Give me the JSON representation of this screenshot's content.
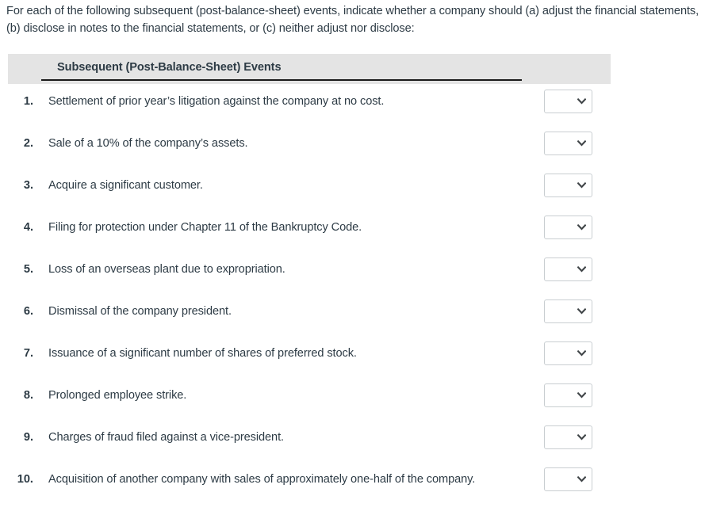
{
  "prompt": {
    "text": "For each of the following subsequent (post-balance-sheet) events, indicate whether a company should (a) adjust the financial statements, (b) disclose in notes to the financial statements, or (c) neither adjust nor disclose:"
  },
  "table": {
    "column_header": "Subsequent (Post-Balance-Sheet) Events",
    "header_bg": "#e4e4e4",
    "text_color": "#2d3b45",
    "rows": [
      {
        "number": "1.",
        "event": "Settlement of prior year’s litigation against the company at no cost.",
        "answer": ""
      },
      {
        "number": "2.",
        "event": "Sale of a 10% of the company’s assets.",
        "answer": ""
      },
      {
        "number": "3.",
        "event": "Acquire a significant customer.",
        "answer": ""
      },
      {
        "number": "4.",
        "event": "Filing for protection under Chapter 11 of the Bankruptcy Code.",
        "answer": ""
      },
      {
        "number": "5.",
        "event": "Loss of an overseas plant due to expropriation.",
        "answer": ""
      },
      {
        "number": "6.",
        "event": "Dismissal of the company president.",
        "answer": ""
      },
      {
        "number": "7.",
        "event": "Issuance of a significant number of shares of preferred stock.",
        "answer": ""
      },
      {
        "number": "8.",
        "event": "Prolonged employee strike.",
        "answer": ""
      },
      {
        "number": "9.",
        "event": "Charges of fraud filed against a vice-president.",
        "answer": ""
      },
      {
        "number": "10.",
        "event": "Acquisition of another company with sales of approximately one-half of the company.",
        "answer": ""
      }
    ]
  },
  "select": {
    "icon": "chevron-down-icon",
    "selected_value": "",
    "arrow_color": "#3f4447"
  }
}
